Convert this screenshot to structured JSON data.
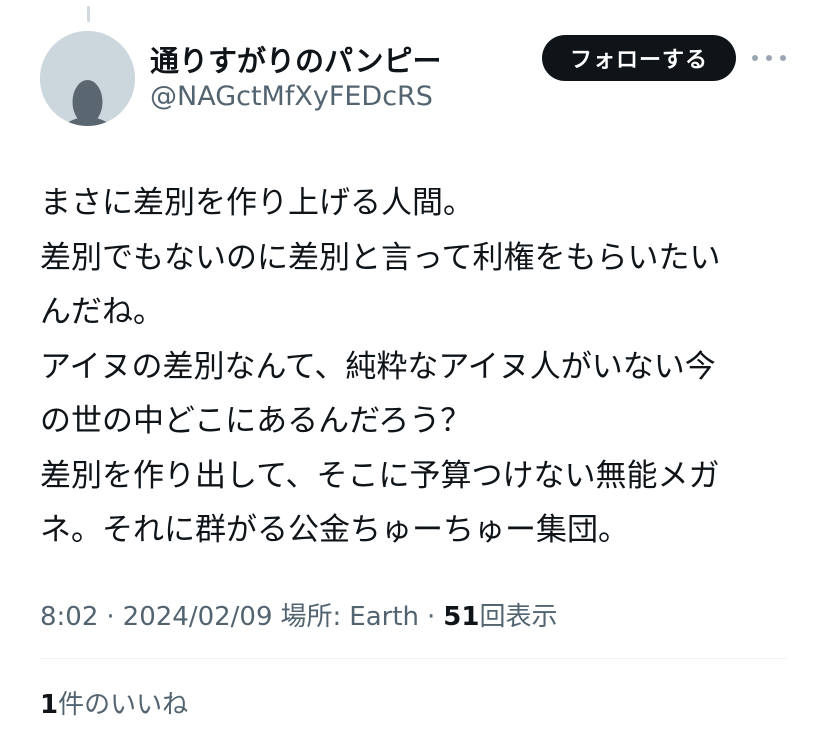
{
  "author": {
    "display_name": "通りすがりのパンピー",
    "handle": "@NAGctMfXyFEDcRS",
    "avatar_icon": "default-profile-icon"
  },
  "actions": {
    "follow_label": "フォローする",
    "more_icon": "more-horizontal-icon"
  },
  "tweet": {
    "lines": [
      "まさに差別を作り上げる人間。",
      "差別でもないのに差別と言って利権をもらいたい",
      "んだね。",
      "アイヌの差別なんて、純粋なアイヌ人がいない今",
      "の世の中どこにあるんだろう？",
      "差別を作り出して、そこに予算つけない無能メガ",
      "ネ。それに群がる公金ちゅーちゅー集団。"
    ]
  },
  "meta": {
    "time": "8:02",
    "separator": "·",
    "date": "2024/02/09",
    "location_label": "場所:",
    "location": "Earth",
    "views_count": "51",
    "views_label": "回表示"
  },
  "engagement": {
    "likes_count": "1",
    "likes_label": "件のいいね"
  },
  "colors": {
    "text_primary": "#0f1419",
    "text_secondary": "#536471",
    "button_bg": "#0f1419",
    "avatar_bg": "#ccd6dd",
    "avatar_fg": "#5b6770",
    "divider": "#eff3f4"
  }
}
